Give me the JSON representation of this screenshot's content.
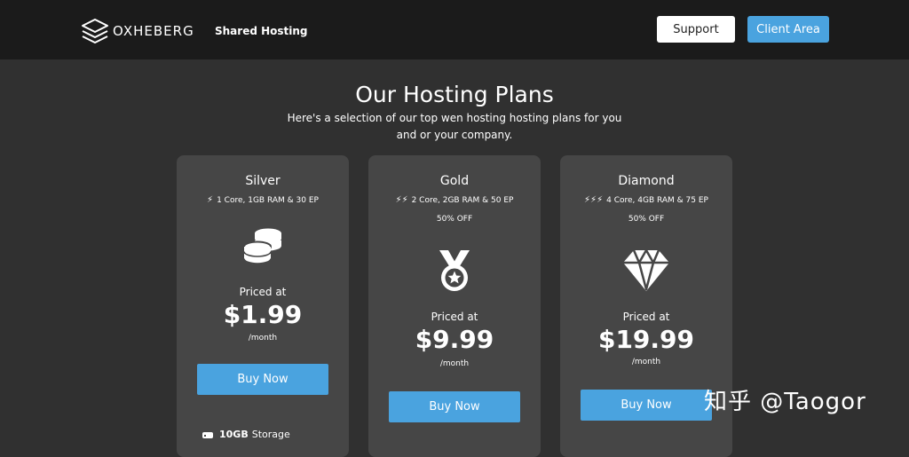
{
  "header": {
    "brand": "OXHEBERG",
    "nav_link": "Shared Hosting",
    "support_label": "Support",
    "client_area_label": "Client Area"
  },
  "hero": {
    "title": "Our Hosting Plans",
    "subtitle": "Here's a selection of our top wen hosting hosting plans for you and or your company."
  },
  "plans": [
    {
      "name": "Silver",
      "bolts": "⚡",
      "spec": "1 Core, 1GB RAM & 30 EP",
      "discount": "",
      "icon": "coins-icon",
      "priced_label": "Priced at",
      "price": "$1.99",
      "period": "/month",
      "buy_label": "Buy Now",
      "feature_value": "10GB",
      "feature_label": "Storage"
    },
    {
      "name": "Gold",
      "bolts": "⚡⚡",
      "spec": "2 Core, 2GB RAM & 50 EP",
      "discount": "50% OFF",
      "icon": "medal-icon",
      "priced_label": "Priced at",
      "price": "$9.99",
      "period": "/month",
      "buy_label": "Buy Now"
    },
    {
      "name": "Diamond",
      "bolts": "⚡⚡⚡",
      "spec": "4 Core, 4GB RAM & 75 EP",
      "discount": "50% OFF",
      "icon": "diamond-icon",
      "priced_label": "Priced at",
      "price": "$19.99",
      "period": "/month",
      "buy_label": "Buy Now"
    }
  ],
  "watermark": "知乎 @Taogor",
  "colors": {
    "accent": "#4aa3df",
    "header_bg": "#1b1b1b",
    "page_bg": "#303030",
    "card_bg": "#464646"
  }
}
